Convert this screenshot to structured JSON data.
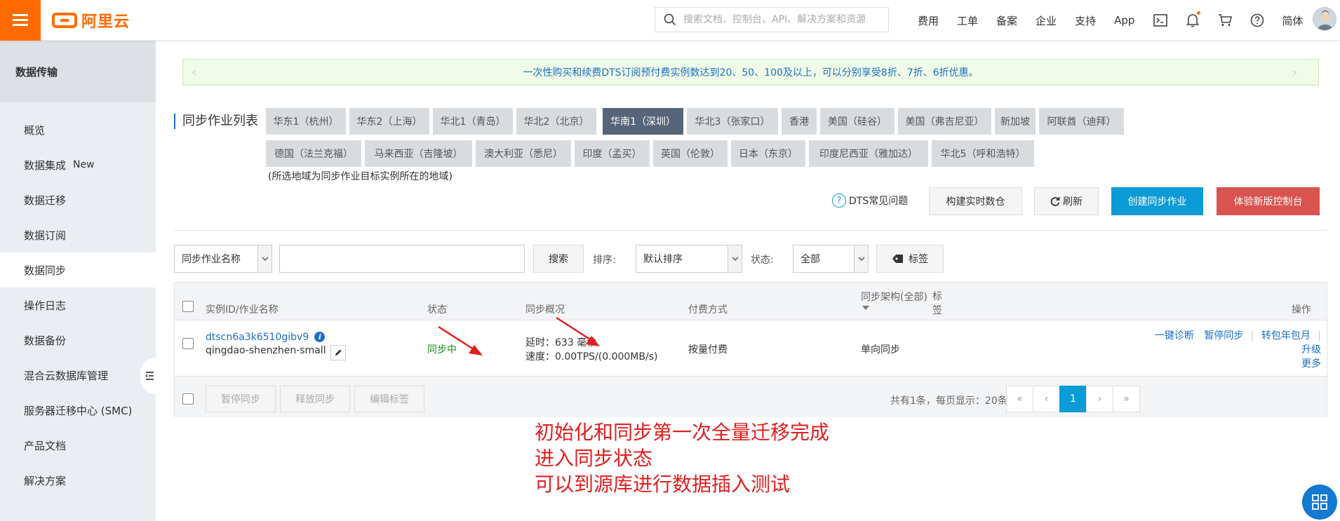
{
  "topbar": {
    "logo_text": "阿里云",
    "search_placeholder": "搜索文档、控制台、API、解决方案和资源",
    "nav": [
      "费用",
      "工单",
      "备案",
      "企业",
      "支持",
      "App"
    ],
    "lang": "简体"
  },
  "sidebar": {
    "title": "数据传输",
    "items": [
      {
        "label": "概览",
        "badge": ""
      },
      {
        "label": "数据集成",
        "badge": "New"
      },
      {
        "label": "数据迁移",
        "badge": ""
      },
      {
        "label": "数据订阅",
        "badge": ""
      },
      {
        "label": "数据同步",
        "badge": ""
      },
      {
        "label": "操作日志",
        "badge": ""
      },
      {
        "label": "数据备份",
        "badge": ""
      },
      {
        "label": "混合云数据库管理",
        "badge": ""
      },
      {
        "label": "服务器迁移中心 (SMC)",
        "badge": ""
      },
      {
        "label": "产品文档",
        "badge": ""
      },
      {
        "label": "解决方案",
        "badge": ""
      }
    ],
    "active_index": 4
  },
  "notice": {
    "text": "一次性购买和续费DTS订阅预付费实例数达到20、50、100及以上，可以分别享受8折、7折、6折优惠。",
    "prev": "‹",
    "next": "›"
  },
  "page_title": "同步作业列表",
  "regions": {
    "row1": [
      "华东1（杭州）",
      "华东2（上海）",
      "华北1（青岛）",
      "华北2（北京）",
      "华南1（深圳）",
      "华北3（张家口）",
      "香港",
      "美国（硅谷）",
      "美国（弗吉尼亚）",
      "新加坡",
      "阿联酋（迪拜）"
    ],
    "row2": [
      "德国（法兰克福）",
      "马来西亚（吉隆坡）",
      "澳大利亚（悉尼）",
      "印度（孟买）",
      "英国（伦敦）",
      "日本（东京）",
      "印度尼西亚（雅加达）",
      "华北5（呼和浩特）"
    ],
    "active": "华南1（深圳）",
    "note": "(所选地域为同步作业目标实例所在的地域)"
  },
  "actions": {
    "faq": "DTS常见问题",
    "build_warehouse": "构建实时数仓",
    "refresh": "刷新",
    "create": "创建同步作业",
    "new_console": "体验新版控制台"
  },
  "filters": {
    "field_select": "同步作业名称",
    "search_value": "",
    "search_btn": "搜索",
    "sort_label": "排序:",
    "sort_select": "默认排序",
    "status_label": "状态:",
    "status_select": "全部",
    "tag_btn": "标签"
  },
  "table": {
    "headers": {
      "id": "实例ID/作业名称",
      "status": "状态",
      "overview": "同步概况",
      "billing": "付费方式",
      "arch": "同步架构(全部)",
      "tag": "标签",
      "ops": "操作"
    },
    "rows": [
      {
        "id": "dtscn6a3k6510gibv9",
        "name": "qingdao-shenzhen-small",
        "status": "同步中",
        "latency": "延时：633 毫秒",
        "speed": "速度：0.00TPS/(0.000MB/s)",
        "billing": "按量付费",
        "arch": "单向同步",
        "ops": [
          "一键诊断",
          "暂停同步",
          "转包年包月",
          "升级",
          "更多"
        ]
      }
    ],
    "footer_buttons": [
      "暂停同步",
      "释放同步",
      "编辑标签"
    ],
    "summary": "共有1条，每页显示：20条",
    "pager": [
      "«",
      "‹",
      "1",
      "›",
      "»"
    ],
    "current_page": "1"
  },
  "annotation": {
    "lines": [
      "初始化和同步第一次全量迁移完成",
      "进入同步状态",
      "可以到源库进行数据插入测试"
    ],
    "color": "#e02020"
  },
  "colors": {
    "brand": "#ff6a00",
    "primary": "#0b9bd7",
    "danger": "#d9534f",
    "region_active": "#56657a"
  }
}
